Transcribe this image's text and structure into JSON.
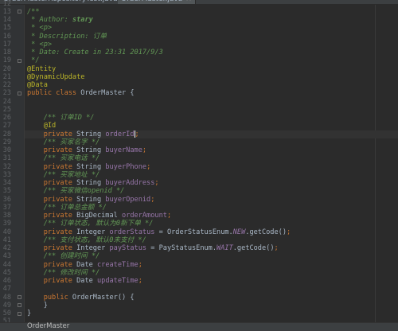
{
  "tabs": [
    {
      "label": "OrderMasterRepositoryTest.java",
      "active": false
    },
    {
      "label": "OrderMaster.java",
      "active": true
    }
  ],
  "status_breadcrumb": "OrderMaster",
  "code": [
    {
      "n": "12",
      "tokens": []
    },
    {
      "n": "13",
      "tokens": [
        {
          "c": "cm",
          "t": "/**"
        }
      ]
    },
    {
      "n": "14",
      "tokens": [
        {
          "c": "cm",
          "t": " * Author: "
        },
        {
          "c": "cmtag",
          "t": "stary"
        }
      ]
    },
    {
      "n": "15",
      "tokens": [
        {
          "c": "cm",
          "t": " * <p>"
        }
      ]
    },
    {
      "n": "16",
      "tokens": [
        {
          "c": "cm",
          "t": " * Description: 订单"
        }
      ]
    },
    {
      "n": "17",
      "tokens": [
        {
          "c": "cm",
          "t": " * <p>"
        }
      ]
    },
    {
      "n": "18",
      "tokens": [
        {
          "c": "cm",
          "t": " * Date: Create in 23:31 2017/9/3"
        }
      ]
    },
    {
      "n": "19",
      "tokens": [
        {
          "c": "cm",
          "t": " */"
        }
      ]
    },
    {
      "n": "20",
      "tokens": [
        {
          "c": "ann",
          "t": "@Entity"
        }
      ]
    },
    {
      "n": "21",
      "tokens": [
        {
          "c": "ann",
          "t": "@DynamicUpdate"
        }
      ]
    },
    {
      "n": "22",
      "tokens": [
        {
          "c": "ann",
          "t": "@Data"
        }
      ]
    },
    {
      "n": "23",
      "tokens": [
        {
          "c": "kw",
          "t": "public class "
        },
        {
          "c": "tx",
          "t": "OrderMaster {"
        }
      ]
    },
    {
      "n": "24",
      "tokens": []
    },
    {
      "n": "25",
      "tokens": []
    },
    {
      "n": "26",
      "tokens": [
        {
          "c": "cm",
          "t": "    /** 订单ID */"
        }
      ]
    },
    {
      "n": "27",
      "tokens": [
        {
          "c": "ann",
          "t": "    @Id"
        }
      ]
    },
    {
      "n": "28",
      "tokens": [
        {
          "c": "kw",
          "t": "    private "
        },
        {
          "c": "tx",
          "t": "String "
        },
        {
          "c": "field",
          "t": "orderId"
        },
        {
          "c": "kw",
          "t": ";"
        }
      ],
      "cursor": true
    },
    {
      "n": "29",
      "tokens": [
        {
          "c": "cm",
          "t": "    /** 买家名字 */"
        }
      ]
    },
    {
      "n": "30",
      "tokens": [
        {
          "c": "kw",
          "t": "    private "
        },
        {
          "c": "tx",
          "t": "String "
        },
        {
          "c": "field",
          "t": "buyerName"
        },
        {
          "c": "kw",
          "t": ";"
        }
      ]
    },
    {
      "n": "31",
      "tokens": [
        {
          "c": "cm",
          "t": "    /** 买家电话 */"
        }
      ]
    },
    {
      "n": "32",
      "tokens": [
        {
          "c": "kw",
          "t": "    private "
        },
        {
          "c": "tx",
          "t": "String "
        },
        {
          "c": "field",
          "t": "buyerPhone"
        },
        {
          "c": "kw",
          "t": ";"
        }
      ]
    },
    {
      "n": "33",
      "tokens": [
        {
          "c": "cm",
          "t": "    /** 买家地址 */"
        }
      ]
    },
    {
      "n": "34",
      "tokens": [
        {
          "c": "kw",
          "t": "    private "
        },
        {
          "c": "tx",
          "t": "String "
        },
        {
          "c": "field",
          "t": "buyerAddress"
        },
        {
          "c": "kw",
          "t": ";"
        }
      ]
    },
    {
      "n": "35",
      "tokens": [
        {
          "c": "cm",
          "t": "    /** 买家微信openid */"
        }
      ]
    },
    {
      "n": "36",
      "tokens": [
        {
          "c": "kw",
          "t": "    private "
        },
        {
          "c": "tx",
          "t": "String "
        },
        {
          "c": "field",
          "t": "buyerOpenid"
        },
        {
          "c": "kw",
          "t": ";"
        }
      ]
    },
    {
      "n": "37",
      "tokens": [
        {
          "c": "cm",
          "t": "    /** 订单总金额 */"
        }
      ]
    },
    {
      "n": "38",
      "tokens": [
        {
          "c": "kw",
          "t": "    private "
        },
        {
          "c": "tx",
          "t": "BigDecimal "
        },
        {
          "c": "field",
          "t": "orderAmount"
        },
        {
          "c": "kw",
          "t": ";"
        }
      ]
    },
    {
      "n": "39",
      "tokens": [
        {
          "c": "cm",
          "t": "    /** 订单状态, 默认为0新下单 */"
        }
      ]
    },
    {
      "n": "40",
      "tokens": [
        {
          "c": "kw",
          "t": "    private "
        },
        {
          "c": "tx",
          "t": "Integer "
        },
        {
          "c": "field",
          "t": "orderStatus"
        },
        {
          "c": "tx",
          "t": " = OrderStatusEnum."
        },
        {
          "c": "stat",
          "t": "NEW"
        },
        {
          "c": "tx",
          "t": ".getCode()"
        },
        {
          "c": "kw",
          "t": ";"
        }
      ]
    },
    {
      "n": "41",
      "tokens": [
        {
          "c": "cm",
          "t": "    /** 支付状态, 默认0未支付 */"
        }
      ]
    },
    {
      "n": "42",
      "tokens": [
        {
          "c": "kw",
          "t": "    private "
        },
        {
          "c": "tx",
          "t": "Integer "
        },
        {
          "c": "field",
          "t": "payStatus"
        },
        {
          "c": "tx",
          "t": " = PayStatusEnum."
        },
        {
          "c": "stat",
          "t": "WAIT"
        },
        {
          "c": "tx",
          "t": ".getCode()"
        },
        {
          "c": "kw",
          "t": ";"
        }
      ]
    },
    {
      "n": "43",
      "tokens": [
        {
          "c": "cm",
          "t": "    /** 创建时间 */"
        }
      ]
    },
    {
      "n": "44",
      "tokens": [
        {
          "c": "kw",
          "t": "    private "
        },
        {
          "c": "tx",
          "t": "Date "
        },
        {
          "c": "field",
          "t": "createTime"
        },
        {
          "c": "kw",
          "t": ";"
        }
      ]
    },
    {
      "n": "45",
      "tokens": [
        {
          "c": "cm",
          "t": "    /** 修改时间 */"
        }
      ]
    },
    {
      "n": "46",
      "tokens": [
        {
          "c": "kw",
          "t": "    private "
        },
        {
          "c": "tx",
          "t": "Date "
        },
        {
          "c": "field",
          "t": "updateTime"
        },
        {
          "c": "kw",
          "t": ";"
        }
      ]
    },
    {
      "n": "47",
      "tokens": []
    },
    {
      "n": "48",
      "tokens": [
        {
          "c": "kw",
          "t": "    public "
        },
        {
          "c": "tx",
          "t": "OrderMaster() {"
        }
      ]
    },
    {
      "n": "49",
      "tokens": [
        {
          "c": "tx",
          "t": "    }"
        }
      ]
    },
    {
      "n": "50",
      "tokens": [
        {
          "c": "tx",
          "t": "}"
        }
      ]
    },
    {
      "n": "51",
      "tokens": []
    }
  ],
  "fold_markers_at_lines": [
    "13",
    "19",
    "23",
    "48",
    "49",
    "50"
  ],
  "colors": {
    "background": "#2b2b2b",
    "keyword": "#cc7832",
    "annotation": "#bbb529",
    "doc_comment": "#629755",
    "field": "#9876aa",
    "text": "#a9b7c6"
  }
}
